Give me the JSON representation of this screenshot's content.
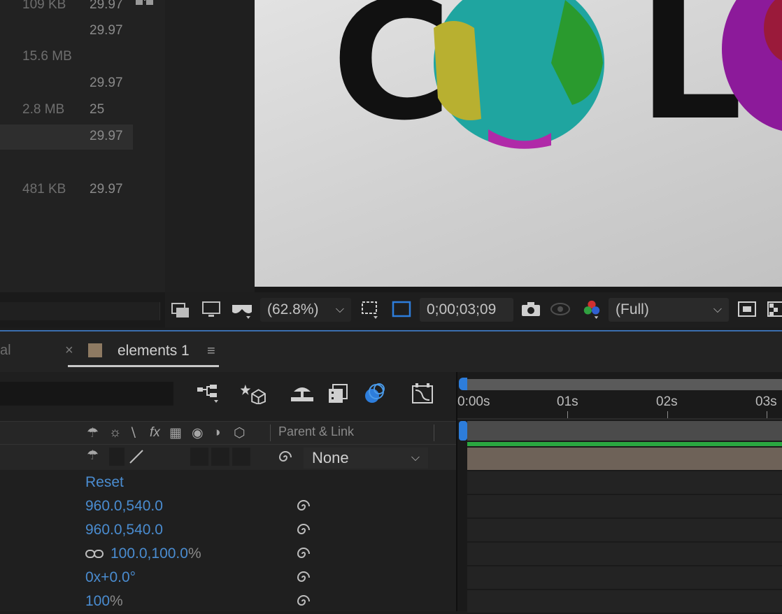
{
  "project": {
    "rows": [
      {
        "size": "109 KB",
        "fps": "29.97"
      },
      {
        "size": "",
        "fps": "29.97"
      },
      {
        "size": "15.6 MB",
        "fps": ""
      },
      {
        "size": "",
        "fps": "29.97"
      },
      {
        "size": "2.8 MB",
        "fps": "25"
      },
      {
        "size": "",
        "fps": "29.97"
      },
      {
        "size": "",
        "fps": ""
      },
      {
        "size": "481 KB",
        "fps": "29.97"
      }
    ]
  },
  "viewer": {
    "letters": [
      "C",
      "L"
    ]
  },
  "viewer_toolbar": {
    "magnification": "(62.8%)",
    "timecode": "0;00;03;09",
    "resolution": "(Full)"
  },
  "timeline": {
    "prev_tab_label": "al",
    "close_glyph": "×",
    "tab_title": "elements 1",
    "menu_glyph": "≡",
    "parent_link_header": "Parent & Link",
    "parent_value": "None",
    "properties": {
      "anchor_reset": "Reset",
      "anchor_point": "960.0,540.0",
      "position": "960.0,540.0",
      "scale": "100.0,100.0",
      "scale_unit": "%",
      "rotation": "0x+0.0°",
      "opacity": "100",
      "opacity_unit": "%"
    },
    "ruler": [
      "0:00s",
      "01s",
      "02s",
      "03s"
    ]
  },
  "colors": {
    "accent_blue": "#2d7ddb",
    "value_blue": "#4a8cd0",
    "track_green": "#2aa640",
    "layer_bar": "#6e6258"
  }
}
